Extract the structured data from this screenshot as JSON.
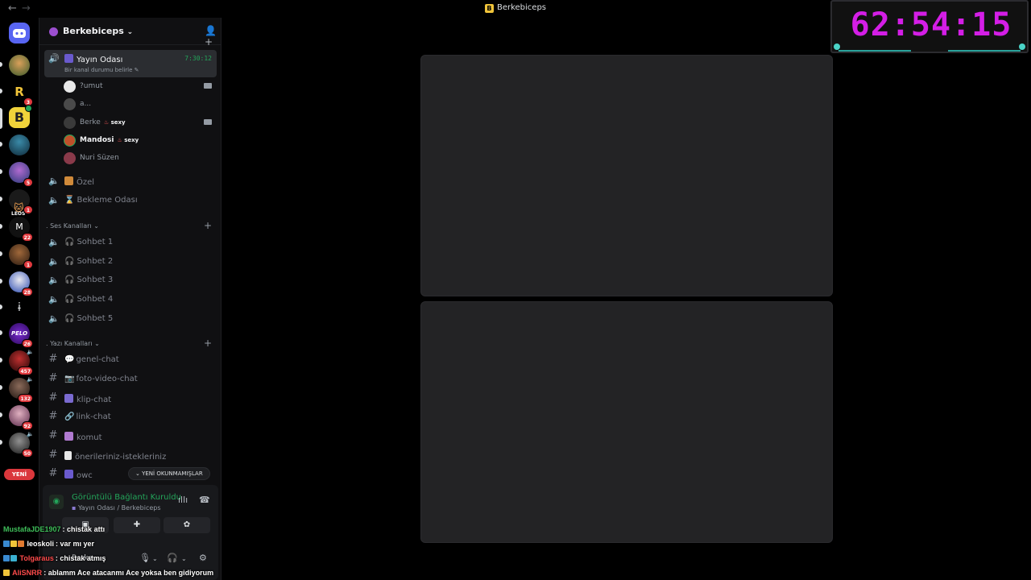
{
  "window": {
    "title": "Berkebiceps",
    "back_arrow": "←",
    "forward_arrow": "→"
  },
  "timer_overlay": {
    "value": "62:54:15",
    "color": "#d41ee6"
  },
  "rail": {
    "servers": [
      {
        "name": "discord-home",
        "badge": ""
      },
      {
        "name": "server-1",
        "badge": ""
      },
      {
        "name": "server-R",
        "letter": "R",
        "badge": "3"
      },
      {
        "name": "server-berkebiceps",
        "letter": "B",
        "badge": ""
      },
      {
        "name": "server-4",
        "badge": ""
      },
      {
        "name": "server-5",
        "badge": "5"
      },
      {
        "name": "server-LEOS",
        "letter": "LEOS",
        "badge": "1"
      },
      {
        "name": "server-M",
        "letter": "M",
        "badge": "22"
      },
      {
        "name": "server-8",
        "badge": "1"
      },
      {
        "name": "server-9",
        "badge": "28"
      },
      {
        "name": "server-10",
        "badge": ""
      },
      {
        "name": "server-PELO",
        "letter": "PELO",
        "badge": "26"
      },
      {
        "name": "server-12",
        "badge": "457"
      },
      {
        "name": "server-13",
        "badge": "132"
      },
      {
        "name": "server-14",
        "badge": "92"
      },
      {
        "name": "server-15",
        "badge": "50"
      }
    ],
    "new_label": "YENİ"
  },
  "guild": {
    "name": "Berkebiceps",
    "chevron": "⌄"
  },
  "voice_channel_active": {
    "name": "Yayın Odası",
    "status_hint": "Bir kanal durumu belirle",
    "elapsed": "7:30:12"
  },
  "members": [
    {
      "name": "?umut",
      "tag": "",
      "camera": true,
      "bold": false
    },
    {
      "name": "a...",
      "tag": "",
      "camera": false,
      "bold": false
    },
    {
      "name": "Berke",
      "tag": "sexy",
      "camera": true,
      "bold": false
    },
    {
      "name": "Mandosi",
      "tag": "sexy",
      "camera": false,
      "bold": true
    },
    {
      "name": "Nuri Süzen",
      "tag": "",
      "camera": false,
      "bold": false
    }
  ],
  "extra_voice": [
    {
      "name": "Özel"
    },
    {
      "name": "Bekleme Odası"
    }
  ],
  "categories": {
    "voice": "Ses Kanalları",
    "text": "Yazı Kanalları"
  },
  "voice_channels": [
    "Sohbet 1",
    "Sohbet 2",
    "Sohbet 3",
    "Sohbet 4",
    "Sohbet 5"
  ],
  "text_channels": [
    "genel-chat",
    "foto-video-chat",
    "klip-chat",
    "link-chat",
    "komut",
    "önerileriniz-istekleriniz",
    "owc"
  ],
  "unread_pill": "YENİ OKUNMAMIŞLAR",
  "voice_panel": {
    "status": "Görüntülü Bağlantı Kuruldu",
    "channel_path": "Yayın Odası / Berkebiceps",
    "username": "Berke"
  },
  "stream_chat": [
    {
      "user": "MustafaJDE1907",
      "message": "chistak attı",
      "color": "#3fbf5a"
    },
    {
      "user": "leoskoli",
      "message": "var mı yer",
      "color": "#ffffff"
    },
    {
      "user": "Tolgaraus",
      "message": "chistak atmış",
      "color": "#ff4b4b"
    },
    {
      "user": "AliSNRR",
      "message": "ablamm Ace atacanmı Ace yoksa ben gidiyorum",
      "color": "#ff4b4b"
    }
  ],
  "colors": {
    "accent_green": "#23a55a",
    "badge_red": "#e0393e",
    "tile_bg": "#232325"
  }
}
